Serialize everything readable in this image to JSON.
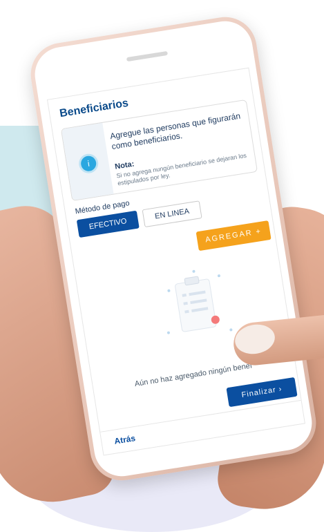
{
  "screen": {
    "title": "Beneficiarios",
    "info": {
      "icon": "info-icon",
      "message": "Agregue las personas que figurarán como beneficiarios.",
      "note_title": "Nota:",
      "note_text": "Si no agrega nungún beneficiario se dejaran los estipulados por ley."
    },
    "payment": {
      "label": "Método de pago",
      "options": [
        "EFECTIVO",
        "EN LINEA"
      ],
      "selected": "EFECTIVO"
    },
    "add_button": "AGREGAR  +",
    "empty_message": "Aún no haz agregado ningún benef",
    "finish_button": "Finalizar  ›",
    "back_link": "Atrás"
  },
  "colors": {
    "primary": "#0b4fa0",
    "accent": "#f5a21c",
    "title": "#0a4a8a",
    "info": "#2aa7e0"
  }
}
